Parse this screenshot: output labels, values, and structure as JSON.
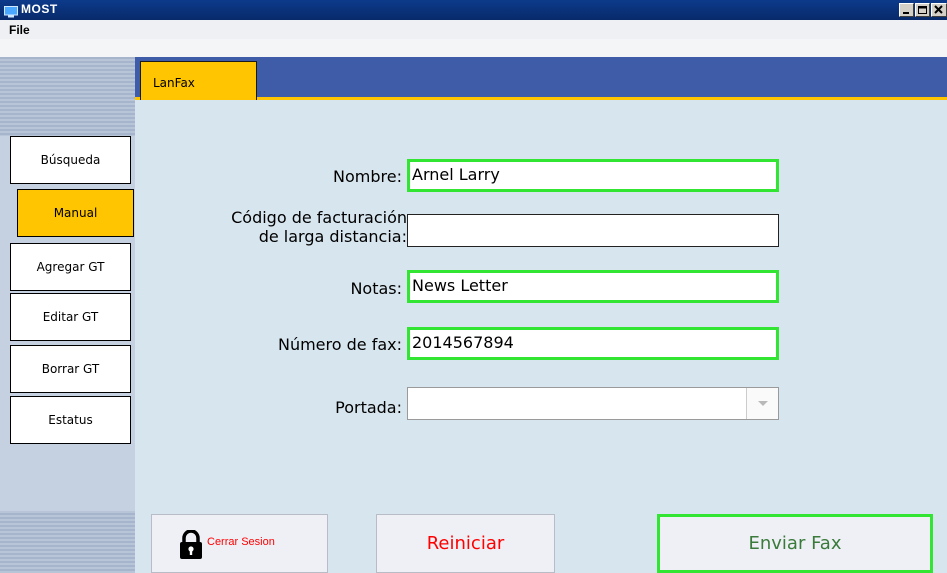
{
  "window": {
    "title": "MOST",
    "icon": "monitor-icon"
  },
  "menubar": {
    "file": "File"
  },
  "sidebar": {
    "items": [
      {
        "label": "Búsqueda",
        "active": false
      },
      {
        "label": "Manual",
        "active": true
      },
      {
        "label": "Agregar GT",
        "active": false
      },
      {
        "label": "Editar GT",
        "active": false
      },
      {
        "label": "Borrar GT",
        "active": false
      },
      {
        "label": "Estatus",
        "active": false
      }
    ]
  },
  "tabs": [
    {
      "label": "LanFax",
      "active": true
    }
  ],
  "form": {
    "nombre": {
      "label": "Nombre:",
      "value": "Arnel Larry"
    },
    "codigo": {
      "label_line1": "Código de facturación",
      "label_line2": "de larga distancia:",
      "value": ""
    },
    "notas": {
      "label": "Notas:",
      "value": "News Letter"
    },
    "fax": {
      "label": "Número de fax:",
      "value": "2014567894"
    },
    "portada": {
      "label": "Portada:",
      "value": ""
    }
  },
  "actions": {
    "logout": "Cerrar Sesion",
    "reset": "Reiniciar",
    "send": "Enviar Fax"
  },
  "colors": {
    "accent_yellow": "#ffc500",
    "tab_bar_blue": "#3f5ca8",
    "panel_bg": "#d7e5ee",
    "valid_green": "#33e533",
    "danger_red": "#ff0000",
    "send_text_green": "#3a7a3a"
  }
}
